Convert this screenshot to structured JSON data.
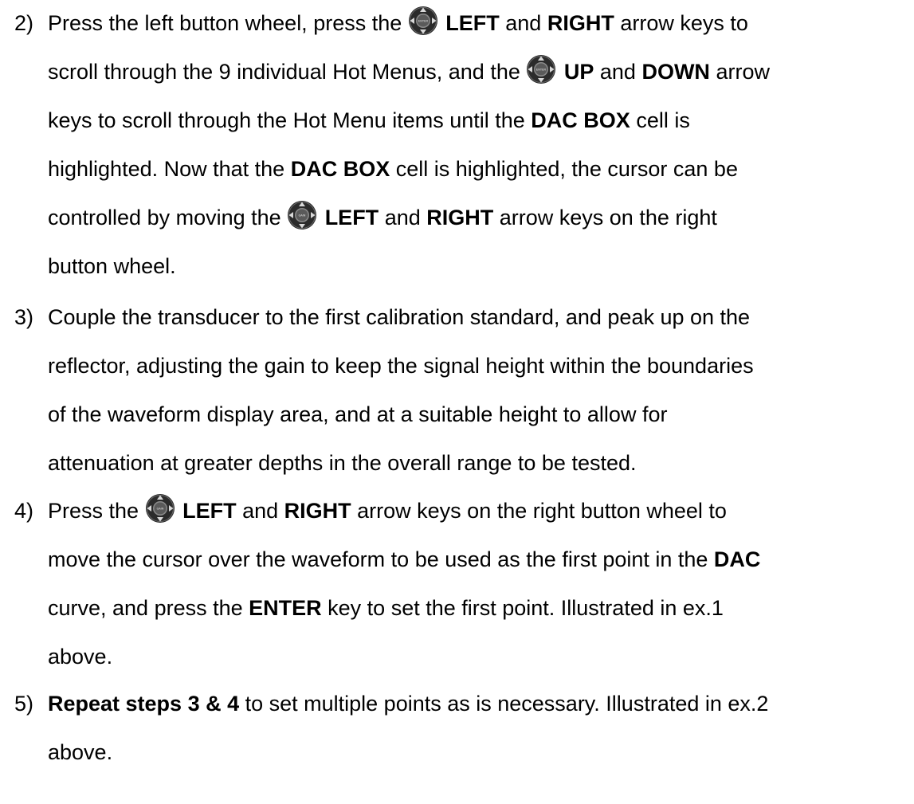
{
  "steps": [
    {
      "number": "2)",
      "lines": [
        [
          {
            "t": "Press the left button wheel, press the "
          },
          {
            "icon": "enter-wheel-icon",
            "center": "ENTER"
          },
          {
            "t": " "
          },
          {
            "b": "LEFT"
          },
          {
            "t": " and "
          },
          {
            "b": "RIGHT"
          },
          {
            "t": " arrow keys to"
          }
        ],
        [
          {
            "t": "scroll through the 9 individual Hot Menus, and the "
          },
          {
            "icon": "enter-wheel-icon",
            "center": "ENTER"
          },
          {
            "t": " "
          },
          {
            "b": "UP"
          },
          {
            "t": " and "
          },
          {
            "b": "DOWN"
          },
          {
            "t": " arrow"
          }
        ],
        [
          {
            "t": "keys to scroll through the Hot Menu items until the "
          },
          {
            "b": "DAC BOX"
          },
          {
            "t": " cell is"
          }
        ],
        [
          {
            "t": "highlighted.  Now that the "
          },
          {
            "b": "DAC BOX"
          },
          {
            "t": " cell is highlighted, the cursor can be"
          }
        ],
        [
          {
            "t": "controlled by moving the "
          },
          {
            "icon": "gain-wheel-icon",
            "center": "GAIN"
          },
          {
            "t": " "
          },
          {
            "b": "LEFT"
          },
          {
            "t": " and "
          },
          {
            "b": "RIGHT"
          },
          {
            "t": " arrow keys on the right"
          }
        ],
        [
          {
            "t": "button wheel."
          }
        ]
      ]
    },
    {
      "number": "3)",
      "lines": [
        [
          {
            "t": "Couple the transducer to the first calibration standard, and peak up on the"
          }
        ],
        [
          {
            "t": "reflector, adjusting the gain to keep the signal height within the boundaries"
          }
        ],
        [
          {
            "t": "of the waveform display area, and at a suitable height to allow for"
          }
        ],
        [
          {
            "t": "attenuation at greater depths in the overall range to be tested."
          }
        ]
      ]
    },
    {
      "number": "4)",
      "lines": [
        [
          {
            "t": "Press the "
          },
          {
            "icon": "gain-wheel-icon",
            "center": "GAIN"
          },
          {
            "t": " "
          },
          {
            "b": "LEFT"
          },
          {
            "t": " and "
          },
          {
            "b": "RIGHT"
          },
          {
            "t": " arrow keys on the right button wheel to"
          }
        ],
        [
          {
            "t": "move the cursor over the waveform to be used as the first point in the "
          },
          {
            "b": "DAC"
          }
        ],
        [
          {
            "t": "curve, and press the "
          },
          {
            "b": "ENTER"
          },
          {
            "t": " key to set the first point.  Illustrated in ex.1"
          }
        ],
        [
          {
            "t": "above."
          }
        ]
      ]
    },
    {
      "number": "5)",
      "lines": [
        [
          {
            "b": "Repeat steps 3 & 4"
          },
          {
            "t": " to set multiple points as is necessary.  Illustrated in ex.2"
          }
        ],
        [
          {
            "t": "above."
          }
        ]
      ]
    }
  ],
  "colors": {
    "text": "#000000",
    "icon_body": "#2b2b2b",
    "icon_arrows": "#d9d9d9"
  }
}
